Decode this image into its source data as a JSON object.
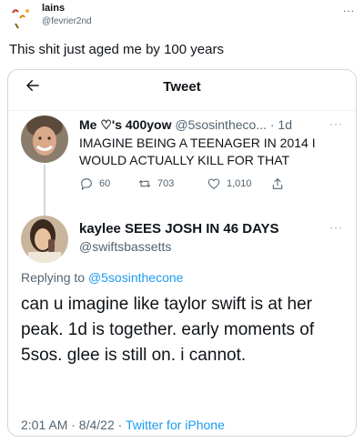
{
  "outer_post": {
    "name": "lains",
    "handle": "@fevrier2nd",
    "more": "...",
    "text": "This shit just aged me by 100 years"
  },
  "tweet_card": {
    "title": "Tweet",
    "quoted": {
      "name": "Me ♡'s 400yow",
      "handle_time": "@5sosintheco... · 1d",
      "text": "IMAGINE BEING A TEENAGER IN 2014 I WOULD ACTUALLY KILL FOR THAT",
      "more": "···",
      "replies": "60",
      "retweets": "703",
      "likes": "1,010"
    },
    "main": {
      "name": "kaylee SEES JOSH IN 46 DAYS",
      "handle": "@swiftsbassetts",
      "more": "···",
      "replying_prefix": "Replying to",
      "replying_mention": "@5sosinthecone",
      "text": "can u imagine like taylor swift is at her peak. 1d is together. early moments of 5sos. glee is still on. i cannot.",
      "timestamp": "2:01 AM · 8/4/22 ·",
      "source": "Twitter for iPhone"
    }
  },
  "colors": {
    "link": "#1d9bf0",
    "secondary_text": "#536471",
    "border": "#cfd9de"
  }
}
